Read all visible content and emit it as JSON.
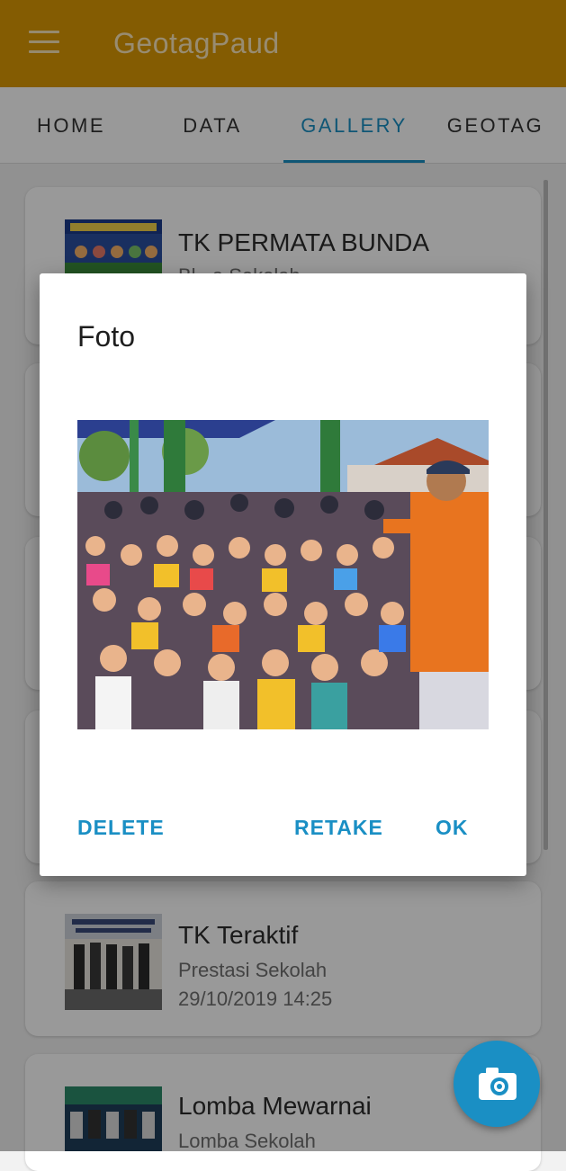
{
  "app": {
    "title": "GeotagPaud"
  },
  "tabs": [
    {
      "label": "HOME"
    },
    {
      "label": "DATA"
    },
    {
      "label": "GALLERY"
    },
    {
      "label": "GEOTAG"
    }
  ],
  "active_tab": "GALLERY",
  "gallery": {
    "items": [
      {
        "title": "TK PERMATA BUNDA",
        "subtitle": "Bl...a Sekolah",
        "date": ""
      },
      {
        "title": "TK Teraktif",
        "subtitle": "Prestasi Sekolah",
        "date": "29/10/2019 14:25"
      },
      {
        "title": "Lomba Mewarnai",
        "subtitle": "Lomba Sekolah",
        "date": ""
      }
    ]
  },
  "dialog": {
    "title": "Foto",
    "buttons": {
      "delete": "DELETE",
      "retake": "RETAKE",
      "ok": "OK"
    }
  },
  "colors": {
    "appbar": "#dd9a04",
    "accent": "#1a8fc4"
  },
  "icons": {
    "menu": "menu-icon",
    "camera": "camera-icon"
  }
}
